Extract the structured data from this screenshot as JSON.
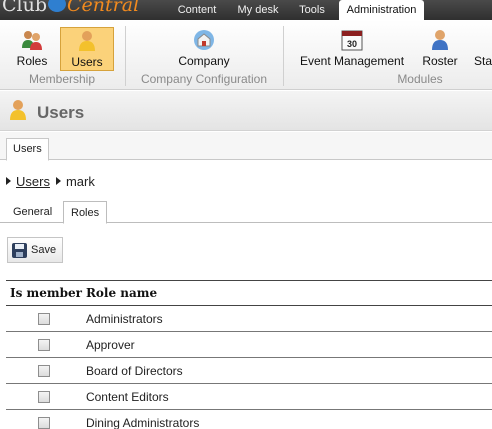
{
  "app": {
    "logo_part1": "Club",
    "logo_part2": "Central"
  },
  "top_nav": [
    {
      "label": "Content",
      "active": false
    },
    {
      "label": "My desk",
      "active": false
    },
    {
      "label": "Tools",
      "active": false
    },
    {
      "label": "Administration",
      "active": true
    }
  ],
  "ribbon": {
    "buttons": [
      {
        "label": "Roles",
        "icon": "roles-icon",
        "selected": false
      },
      {
        "label": "Users",
        "icon": "user-icon",
        "selected": true
      },
      {
        "label": "Company",
        "icon": "company-icon",
        "selected": false
      },
      {
        "label": "Event Management",
        "icon": "calendar-icon",
        "selected": false,
        "icon_text": "30"
      },
      {
        "label": "Roster",
        "icon": "person-icon",
        "selected": false
      },
      {
        "label": "Sta",
        "icon": "",
        "selected": false
      }
    ],
    "groups": [
      "Membership",
      "Company Configuration",
      "Modules"
    ]
  },
  "page": {
    "title": "Users",
    "icon": "user-icon"
  },
  "object_tabs": [
    {
      "label": "Users",
      "active": true
    }
  ],
  "breadcrumb": {
    "parent": "Users",
    "current": "mark"
  },
  "sub_tabs": [
    {
      "label": "General",
      "active": false
    },
    {
      "label": "Roles",
      "active": true
    }
  ],
  "toolbar": {
    "save_label": "Save"
  },
  "table": {
    "headers": [
      "Is member",
      "Role name"
    ],
    "rows": [
      {
        "checked": false,
        "role": "Administrators"
      },
      {
        "checked": false,
        "role": "Approver"
      },
      {
        "checked": false,
        "role": "Board of Directors"
      },
      {
        "checked": false,
        "role": "Content Editors"
      },
      {
        "checked": false,
        "role": "Dining Administrators"
      }
    ]
  },
  "colors": {
    "accent_orange": "#f28a1e",
    "selected_bg": "#fbd27a",
    "topbar": "#3a3a3a"
  }
}
